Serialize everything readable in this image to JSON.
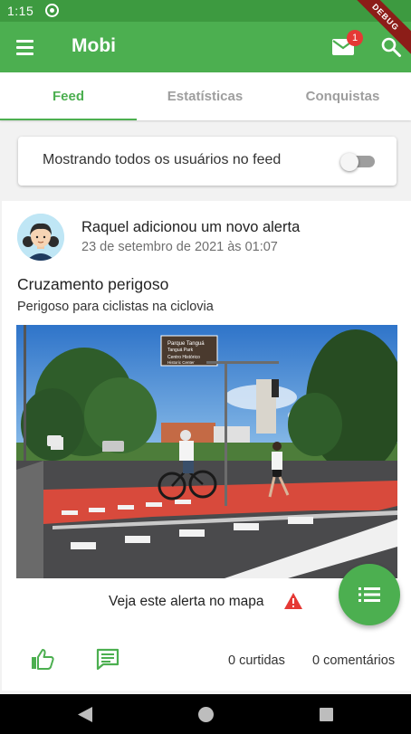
{
  "status_bar": {
    "time": "1:15"
  },
  "debug_banner": "DEBUG",
  "app_bar": {
    "title": "Mobi",
    "mail_badge_count": "1"
  },
  "tabs": [
    {
      "label": "Feed",
      "active": true
    },
    {
      "label": "Estatísticas",
      "active": false
    },
    {
      "label": "Conquistas",
      "active": false
    }
  ],
  "feed_filter": {
    "label": "Mostrando todos os usuários no feed",
    "toggle_on": false
  },
  "post": {
    "author_line": "Raquel adicionou um novo alerta",
    "date": "23 de setembro de 2021 às 01:07",
    "title": "Cruzamento perigoso",
    "description": "Perigoso para ciclistas na ciclovia",
    "image_sign": {
      "line1": "Parque Tanguá",
      "line2": "Tanguá Park",
      "line3": "Centro Histórico",
      "line4": "Historic Center"
    },
    "map_link": "Veja este alerta no mapa",
    "likes": "0 curtidas",
    "comments": "0 comentários"
  },
  "colors": {
    "primary": "#4caf50",
    "status_bar": "#3d9a40",
    "badge": "#e53935",
    "warning": "#e53935"
  },
  "icons": [
    "menu-icon",
    "mail-icon",
    "search-icon",
    "warning-icon",
    "thumb-up-icon",
    "comment-icon",
    "list-icon",
    "nav-back-icon",
    "nav-home-icon",
    "nav-recent-icon"
  ]
}
